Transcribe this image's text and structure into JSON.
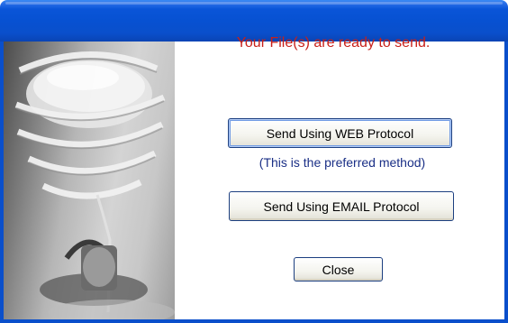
{
  "dialog": {
    "message": "Your File(s) are ready to send.",
    "hint": "(This is the preferred method)",
    "buttons": {
      "web": "Send Using WEB Protocol",
      "email": "Send Using EMAIL Protocol",
      "close": "Close"
    }
  },
  "colors": {
    "titlebar": "#0751d2",
    "message": "#c8201a",
    "hint": "#1a2f86"
  }
}
